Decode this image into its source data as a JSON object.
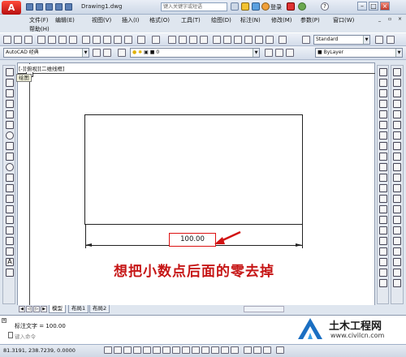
{
  "titlebar": {
    "app_logo": "A",
    "document_title": "Drawing1.dwg",
    "search_placeholder": "键入关键字或短语",
    "user_name": "登录",
    "help_icon": "?"
  },
  "menubar": {
    "items": [
      "文件(F)",
      "编辑(E)",
      "视图(V)",
      "插入(I)",
      "格式(O)",
      "工具(T)",
      "绘图(D)",
      "标注(N)",
      "修改(M)",
      "参数(P)",
      "窗口(W)",
      "帮助(H)"
    ]
  },
  "toolbar1": {
    "text_style": "Standard"
  },
  "toolbar2": {
    "workspace": "AutoCAD 经典",
    "layer": "0",
    "color": "ByLayer"
  },
  "viewport": {
    "label": "[-][俯视][二维线框]",
    "tooltip": "绘图"
  },
  "drawing": {
    "dimension_text": "100.00",
    "annotation": "想把小数点后面的零去掉"
  },
  "tabs": {
    "items": [
      "模型",
      "布局1",
      "布局2"
    ],
    "active": "模型"
  },
  "command": {
    "history": "标注文字 = 100.00",
    "input_placeholder": "键入命令"
  },
  "statusbar": {
    "coordinates": "81.3191, 238.7239, 0.0000"
  },
  "watermark": {
    "title": "土木工程网",
    "url": "www.civilcn.com"
  },
  "colors": {
    "accent_red": "#d11111",
    "annotation_red": "#c61616",
    "watermark_blue": "#1b6fc2"
  }
}
